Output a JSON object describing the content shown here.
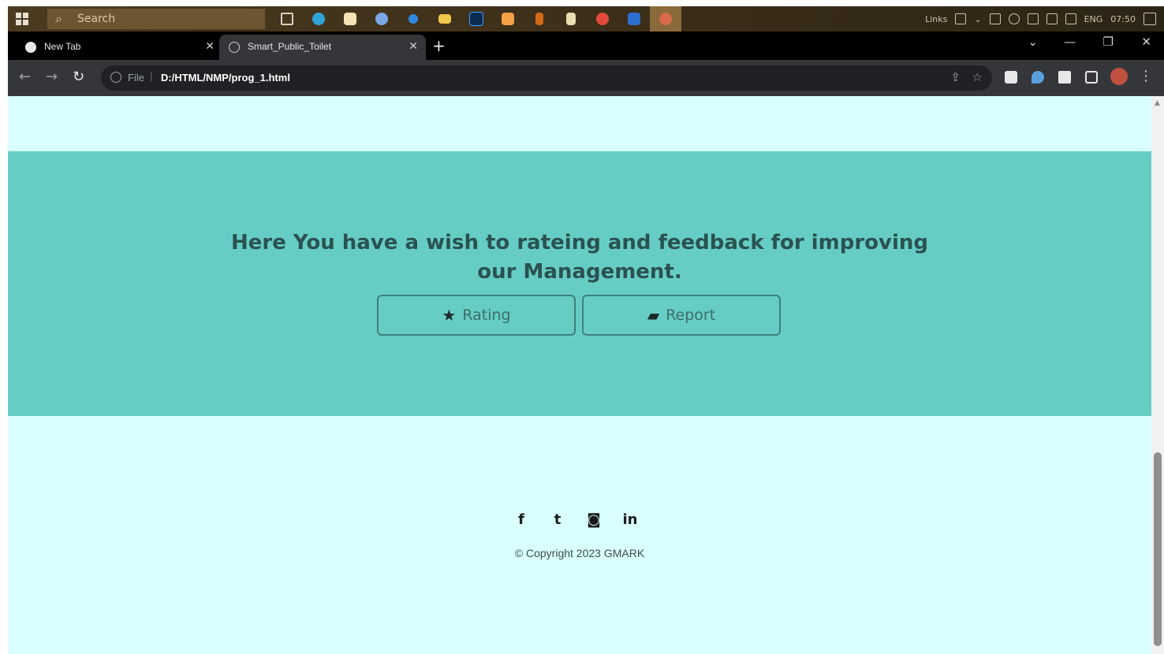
{
  "taskbar": {
    "search_placeholder": "Search",
    "pinned_icons": [
      "task-view-icon",
      "edge-icon",
      "file-icon",
      "chrome-icon",
      "browser-icon",
      "folder-icon",
      "photoshop-icon",
      "app-icon",
      "media-icon",
      "notes-icon",
      "chrome-icon",
      "outlook-icon",
      "paint-icon"
    ],
    "tray_label": "Links",
    "language": "ENG",
    "time": "07:50"
  },
  "tabs": [
    {
      "title": "New Tab"
    },
    {
      "title": "Smart_Public_Toilet"
    }
  ],
  "toolbar": {
    "scheme": "File",
    "url": "D:/HTML/NMP/prog_1.html"
  },
  "page": {
    "feedback_heading": "Here You have a wish to rateing and feedback for improving our Management.",
    "rating_label": "Rating",
    "report_label": "Report",
    "copyright": "© Copyright 2023 GMARK"
  },
  "colors": {
    "page_bg": "#d9ffff",
    "band_bg": "#66cdc5",
    "heading": "#2a5250",
    "button_border": "#3f807b"
  }
}
